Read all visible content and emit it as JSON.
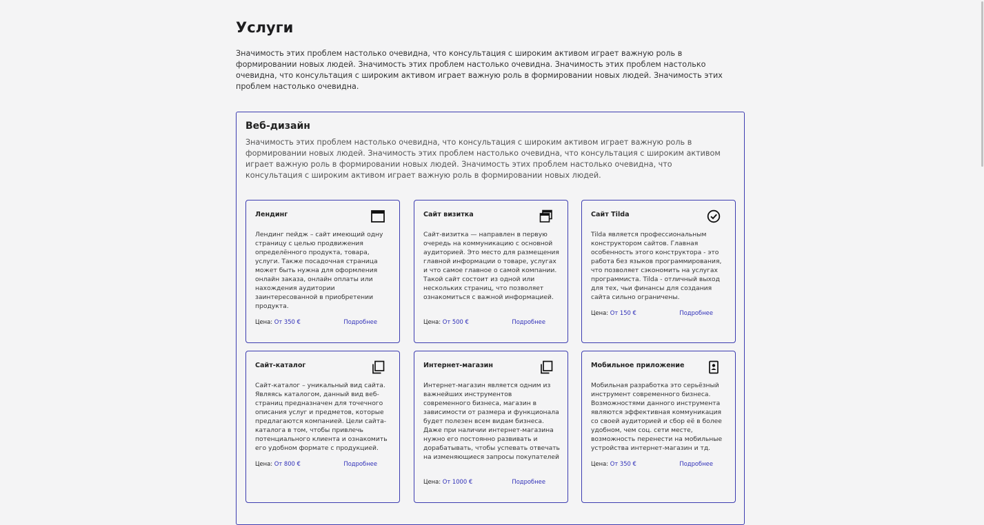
{
  "services": {
    "title": "Услуги",
    "intro": "Значимость этих проблем настолько очевидна, что консультация с широким активом играет важную роль в формировании новых людей. Значимость этих проблем настолько очевидна. Значимость этих проблем настолько очевидна, что консультация с широким активом играет важную роль в формировании новых людей. Значимость этих проблем настолько очевидна."
  },
  "webdesign": {
    "title": "Веб-дизайн",
    "description": "Значимость этих проблем настолько очевидна, что консультация с широким активом играет важную роль в формировании новых людей. Значимость этих проблем настолько очевидна, что консультация с широким активом играет важную роль в формировании новых людей. Значимость этих проблем настолько очевидна, что консультация с широким активом играет важную роль в формировании новых людей."
  },
  "cards": [
    {
      "title": "Лендинг",
      "icon": "browser-window-icon",
      "text": "Лендинг пейдж – сайт имеющий одну страницу с целью продвижения определённого продукта, товара, услуги. Также посадочная страница может быть нужна для оформления онлайн заказа, онлайн оплаты или нахождения аудитории заинтересованной в приобретении продукта.",
      "price_label": "Цена:",
      "price_value": "От 350 €",
      "more_label": "Подробнее"
    },
    {
      "title": "Сайт визитка",
      "icon": "stacked-windows-icon",
      "text": "Сайт-визитка — направлен в первую очередь на коммуникацию с основной аудиторией. Это место для размещения главной информации о товаре, услугах и что самое главное о самой компании. Такой сайт состоит из одной или нескольких страниц, что позволяет ознакомиться с важной информацией.",
      "price_label": "Цена:",
      "price_value": "От 500 €",
      "more_label": "Подробнее"
    },
    {
      "title": "Сайт Tilda",
      "icon": "check-circle-icon",
      "text": "Tilda является профессиональным конструктором сайтов. Главная особенность этого конструктора - это работа без языков программирования, что позволяет сэкономить на услугах программиста. Tilda - отличный выход для тех, чьи финансы для создания сайта сильно ограничены.",
      "price_label": "Цена:",
      "price_value": "От 150 €",
      "more_label": "Подробнее"
    },
    {
      "title": "Сайт-каталог",
      "icon": "copy-pages-icon",
      "text": "Сайт-каталог – уникальный вид сайта. Являясь каталогом, данный вид веб-страниц предназначен для точечного описания услуг и предметов, которые предлагаются компанией. Цели сайта-каталога в том, чтобы привлечь потенциального клиента и ознакомить его удобном формате с продукцией.",
      "price_label": "Цена:",
      "price_value": "От 800 €",
      "more_label": "Подробнее"
    },
    {
      "title": "Интернет-магазин",
      "icon": "copy-pages-icon",
      "text": "Интернет-магазин является одним из важнейших инструментов современного бизнеса, магазин в зависимости от размера и функционала будет полезен всем видам бизнеса. Даже при наличии интернет-магазина нужно его постоянно развивать и дорабатывать, чтобы успевать отвечать на изменяющиеся запросы покупателей",
      "price_label": "Цена:",
      "price_value": "От 1000 €",
      "more_label": "Подробнее"
    },
    {
      "title": "Мобильное приложение",
      "icon": "contact-card-icon",
      "text": "Мобильная разработка это серьёзный инструмент современного бизнеса. Возможностями данного инструмента являются эффективная коммуникация со своей аудиторией и сбор её в более удобном, чем соц. сети месте, возможность перенести на мобильные устройства интернет-магазин и тд.",
      "price_label": "Цена:",
      "price_value": "От 350 €",
      "more_label": "Подробнее"
    }
  ]
}
